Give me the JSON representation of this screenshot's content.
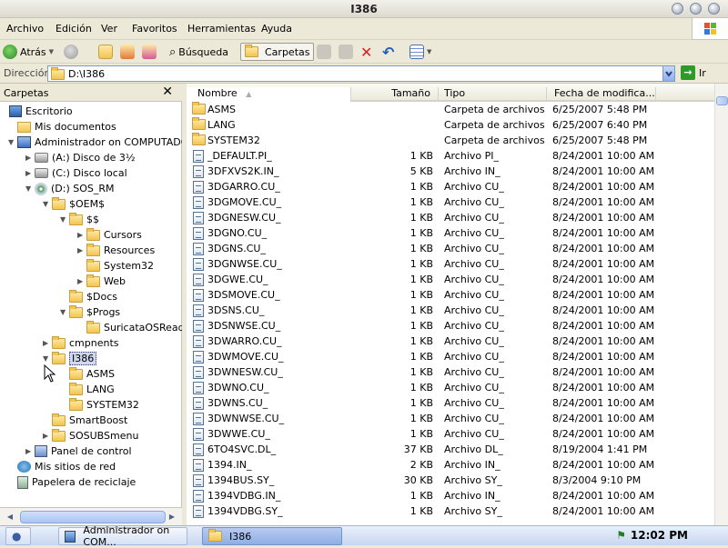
{
  "window": {
    "title": "I386"
  },
  "menu": [
    "Archivo",
    "Edición",
    "Ver",
    "Favoritos",
    "Herramientas",
    "Ayuda"
  ],
  "toolbar": {
    "back": "Atrás",
    "search": "Búsqueda",
    "folders": "Carpetas"
  },
  "address": {
    "label": "Dirección",
    "value": "D:\\I386",
    "go": "Ir"
  },
  "left_pane": {
    "title": "Carpetas",
    "close": "✕",
    "tree": [
      {
        "label": "Escritorio",
        "indent": 0,
        "icon": "desk",
        "exp": ""
      },
      {
        "label": "Mis documentos",
        "indent": 1,
        "icon": "docs",
        "exp": ""
      },
      {
        "label": "Administrador on COMPUTADORA",
        "indent": 1,
        "icon": "comp",
        "exp": "▼"
      },
      {
        "label": "(A:) Disco de 3½",
        "indent": 2,
        "icon": "drive",
        "exp": "▶"
      },
      {
        "label": "(C:) Disco local",
        "indent": 2,
        "icon": "drive",
        "exp": "▶"
      },
      {
        "label": "(D:) SOS_RM",
        "indent": 2,
        "icon": "cd",
        "exp": "▼"
      },
      {
        "label": "$OEM$",
        "indent": 3,
        "icon": "fold",
        "exp": "▼"
      },
      {
        "label": "$$",
        "indent": 4,
        "icon": "fold",
        "exp": "▼"
      },
      {
        "label": "Cursors",
        "indent": 5,
        "icon": "fold",
        "exp": "▶"
      },
      {
        "label": "Resources",
        "indent": 5,
        "icon": "fold",
        "exp": "▶"
      },
      {
        "label": "System32",
        "indent": 5,
        "icon": "fold",
        "exp": ""
      },
      {
        "label": "Web",
        "indent": 5,
        "icon": "fold",
        "exp": "▶"
      },
      {
        "label": "$Docs",
        "indent": 4,
        "icon": "fold",
        "exp": ""
      },
      {
        "label": "$Progs",
        "indent": 4,
        "icon": "fold",
        "exp": "▼"
      },
      {
        "label": "SuricataOSReadme",
        "indent": 5,
        "icon": "fold",
        "exp": ""
      },
      {
        "label": "cmpnents",
        "indent": 3,
        "icon": "fold",
        "exp": "▶"
      },
      {
        "label": "I386",
        "indent": 3,
        "icon": "fold",
        "exp": "▼",
        "selected": true
      },
      {
        "label": "ASMS",
        "indent": 4,
        "icon": "fold",
        "exp": ""
      },
      {
        "label": "LANG",
        "indent": 4,
        "icon": "fold",
        "exp": ""
      },
      {
        "label": "SYSTEM32",
        "indent": 4,
        "icon": "fold",
        "exp": ""
      },
      {
        "label": "SmartBoost",
        "indent": 3,
        "icon": "fold",
        "exp": ""
      },
      {
        "label": "SOSUBSmenu",
        "indent": 3,
        "icon": "fold",
        "exp": "▶"
      },
      {
        "label": "Panel de control",
        "indent": 2,
        "icon": "ctrl",
        "exp": "▶"
      },
      {
        "label": "Mis sitios de red",
        "indent": 1,
        "icon": "net",
        "exp": ""
      },
      {
        "label": "Papelera de reciclaje",
        "indent": 1,
        "icon": "bin",
        "exp": ""
      }
    ]
  },
  "columns": {
    "name": "Nombre",
    "size": "Tamaño",
    "type": "Tipo",
    "date": "Fecha de modifica..."
  },
  "files": [
    {
      "name": "ASMS",
      "size": "",
      "type": "Carpeta de archivos",
      "date": "6/25/2007 5:48 PM",
      "folder": true
    },
    {
      "name": "LANG",
      "size": "",
      "type": "Carpeta de archivos",
      "date": "6/25/2007 6:40 PM",
      "folder": true
    },
    {
      "name": "SYSTEM32",
      "size": "",
      "type": "Carpeta de archivos",
      "date": "6/25/2007 5:48 PM",
      "folder": true
    },
    {
      "name": "_DEFAULT.PI_",
      "size": "1 KB",
      "type": "Archivo PI_",
      "date": "8/24/2001 10:00 AM"
    },
    {
      "name": "3DFXVS2K.IN_",
      "size": "5 KB",
      "type": "Archivo IN_",
      "date": "8/24/2001 10:00 AM"
    },
    {
      "name": "3DGARRO.CU_",
      "size": "1 KB",
      "type": "Archivo CU_",
      "date": "8/24/2001 10:00 AM"
    },
    {
      "name": "3DGMOVE.CU_",
      "size": "1 KB",
      "type": "Archivo CU_",
      "date": "8/24/2001 10:00 AM"
    },
    {
      "name": "3DGNESW.CU_",
      "size": "1 KB",
      "type": "Archivo CU_",
      "date": "8/24/2001 10:00 AM"
    },
    {
      "name": "3DGNO.CU_",
      "size": "1 KB",
      "type": "Archivo CU_",
      "date": "8/24/2001 10:00 AM"
    },
    {
      "name": "3DGNS.CU_",
      "size": "1 KB",
      "type": "Archivo CU_",
      "date": "8/24/2001 10:00 AM"
    },
    {
      "name": "3DGNWSE.CU_",
      "size": "1 KB",
      "type": "Archivo CU_",
      "date": "8/24/2001 10:00 AM"
    },
    {
      "name": "3DGWE.CU_",
      "size": "1 KB",
      "type": "Archivo CU_",
      "date": "8/24/2001 10:00 AM"
    },
    {
      "name": "3DSMOVE.CU_",
      "size": "1 KB",
      "type": "Archivo CU_",
      "date": "8/24/2001 10:00 AM"
    },
    {
      "name": "3DSNS.CU_",
      "size": "1 KB",
      "type": "Archivo CU_",
      "date": "8/24/2001 10:00 AM"
    },
    {
      "name": "3DSNWSE.CU_",
      "size": "1 KB",
      "type": "Archivo CU_",
      "date": "8/24/2001 10:00 AM"
    },
    {
      "name": "3DWARRO.CU_",
      "size": "1 KB",
      "type": "Archivo CU_",
      "date": "8/24/2001 10:00 AM"
    },
    {
      "name": "3DWMOVE.CU_",
      "size": "1 KB",
      "type": "Archivo CU_",
      "date": "8/24/2001 10:00 AM"
    },
    {
      "name": "3DWNESW.CU_",
      "size": "1 KB",
      "type": "Archivo CU_",
      "date": "8/24/2001 10:00 AM"
    },
    {
      "name": "3DWNO.CU_",
      "size": "1 KB",
      "type": "Archivo CU_",
      "date": "8/24/2001 10:00 AM"
    },
    {
      "name": "3DWNS.CU_",
      "size": "1 KB",
      "type": "Archivo CU_",
      "date": "8/24/2001 10:00 AM"
    },
    {
      "name": "3DWNWSE.CU_",
      "size": "1 KB",
      "type": "Archivo CU_",
      "date": "8/24/2001 10:00 AM"
    },
    {
      "name": "3DWWE.CU_",
      "size": "1 KB",
      "type": "Archivo CU_",
      "date": "8/24/2001 10:00 AM"
    },
    {
      "name": "6TO4SVC.DL_",
      "size": "37 KB",
      "type": "Archivo DL_",
      "date": "8/19/2004 1:41 PM"
    },
    {
      "name": "1394.IN_",
      "size": "2 KB",
      "type": "Archivo IN_",
      "date": "8/24/2001 10:00 AM"
    },
    {
      "name": "1394BUS.SY_",
      "size": "30 KB",
      "type": "Archivo SY_",
      "date": "8/3/2004 9:10 PM"
    },
    {
      "name": "1394VDBG.IN_",
      "size": "1 KB",
      "type": "Archivo IN_",
      "date": "8/24/2001 10:00 AM"
    },
    {
      "name": "1394VDBG.SY_",
      "size": "1 KB",
      "type": "Archivo SY_",
      "date": "8/24/2001 10:00 AM"
    }
  ],
  "taskbar": {
    "task1": "Administrador on COM...",
    "task2": "I386",
    "clock": "12:02 PM"
  }
}
